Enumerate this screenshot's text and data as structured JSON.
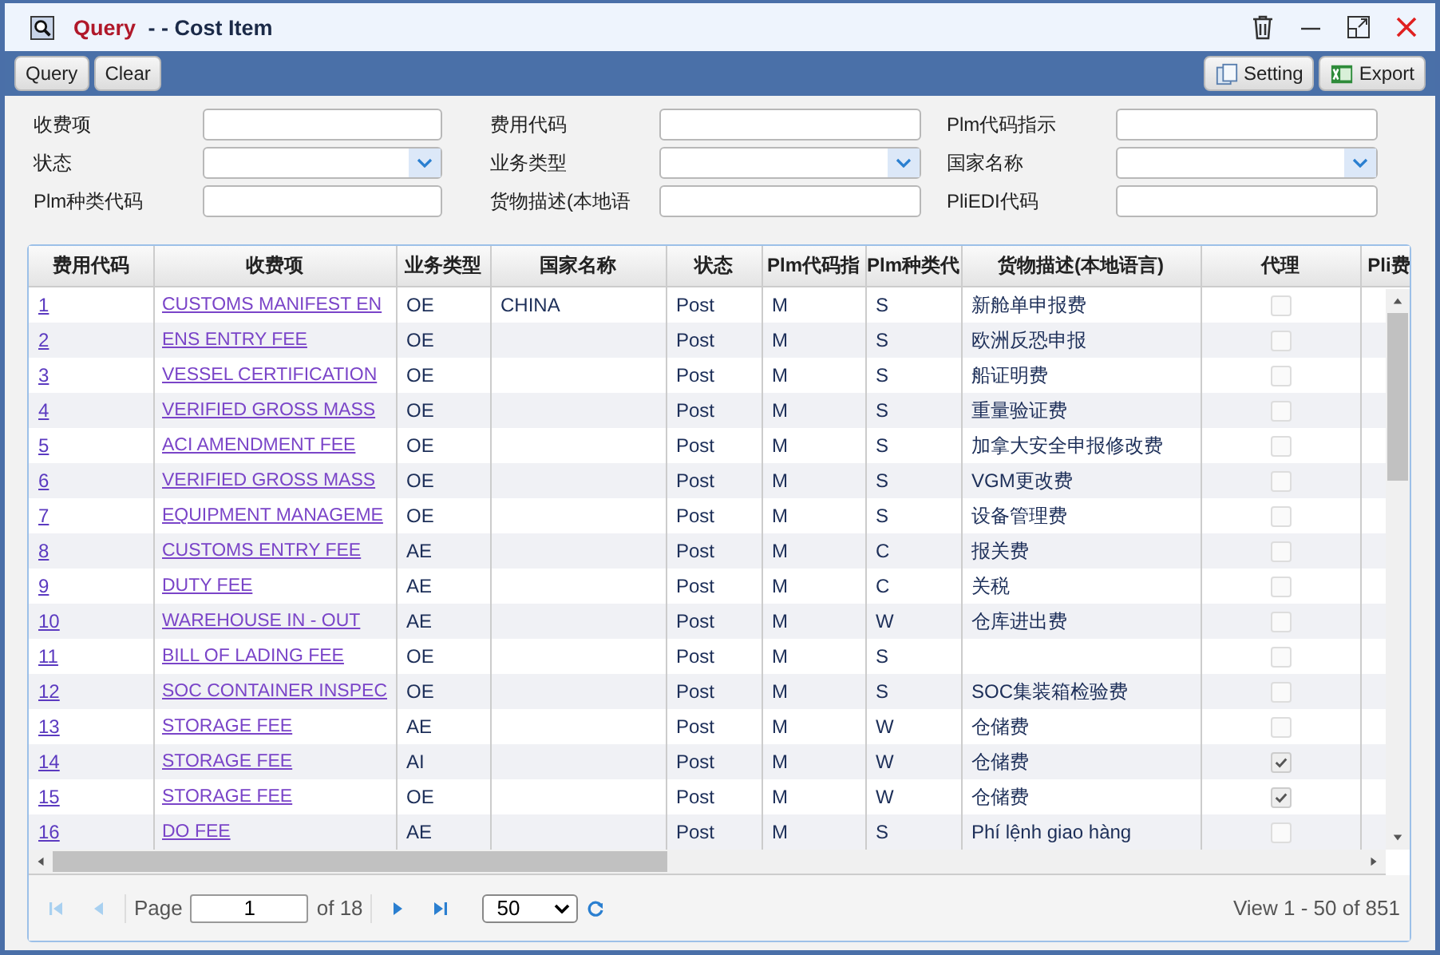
{
  "window": {
    "title_prefix": "Query",
    "title_rest": " - - Cost Item"
  },
  "toolbar": {
    "left": [
      {
        "label": "Query"
      },
      {
        "label": "Clear"
      }
    ],
    "right": [
      {
        "label": "Setting",
        "kind": "setting"
      },
      {
        "label": "Export",
        "kind": "excel"
      }
    ]
  },
  "form": [
    {
      "label": "收费项",
      "kind": "text"
    },
    {
      "label": "费用代码",
      "kind": "text"
    },
    {
      "label": "Plm代码指示",
      "kind": "text"
    },
    {
      "label": "状态",
      "kind": "select"
    },
    {
      "label": "业务类型",
      "kind": "select"
    },
    {
      "label": "国家名称",
      "kind": "select"
    },
    {
      "label": "Plm种类代码",
      "kind": "text"
    },
    {
      "label": "货物描述(本地语",
      "kind": "text"
    },
    {
      "label": "PliEDI代码",
      "kind": "text"
    }
  ],
  "table": {
    "columns": [
      "费用代码",
      "收费项",
      "业务类型",
      "国家名称",
      "状态",
      "Plm代码指",
      "Plm种类代",
      "货物描述(本地语言)",
      "代理",
      "Pli费"
    ],
    "rows": [
      {
        "code": "1",
        "item": "CUSTOMS MANIFEST EN",
        "business_type": "OE",
        "country": "CHINA",
        "status": "Post",
        "plm_code": "M",
        "plm_kind": "S",
        "description": "新舱单申报费",
        "checked": false
      },
      {
        "code": "2",
        "item": "ENS ENTRY FEE",
        "business_type": "OE",
        "country": "",
        "status": "Post",
        "plm_code": "M",
        "plm_kind": "S",
        "description": "欧洲反恐申报",
        "checked": false
      },
      {
        "code": "3",
        "item": "VESSEL CERTIFICATION",
        "business_type": "OE",
        "country": "",
        "status": "Post",
        "plm_code": "M",
        "plm_kind": "S",
        "description": "船证明费",
        "checked": false
      },
      {
        "code": "4",
        "item": "VERIFIED GROSS MASS",
        "business_type": "OE",
        "country": "",
        "status": "Post",
        "plm_code": "M",
        "plm_kind": "S",
        "description": "重量验证费",
        "checked": false
      },
      {
        "code": "5",
        "item": "ACI AMENDMENT FEE",
        "business_type": "OE",
        "country": "",
        "status": "Post",
        "plm_code": "M",
        "plm_kind": "S",
        "description": "加拿大安全申报修改费",
        "checked": false
      },
      {
        "code": "6",
        "item": "VERIFIED GROSS MASS",
        "business_type": "OE",
        "country": "",
        "status": "Post",
        "plm_code": "M",
        "plm_kind": "S",
        "description": "VGM更改费",
        "checked": false
      },
      {
        "code": "7",
        "item": "EQUIPMENT MANAGEME",
        "business_type": "OE",
        "country": "",
        "status": "Post",
        "plm_code": "M",
        "plm_kind": "S",
        "description": "设备管理费",
        "checked": false
      },
      {
        "code": "8",
        "item": "CUSTOMS ENTRY FEE",
        "business_type": "AE",
        "country": "",
        "status": "Post",
        "plm_code": "M",
        "plm_kind": "C",
        "description": "报关费",
        "checked": false
      },
      {
        "code": "9",
        "item": "DUTY FEE",
        "business_type": "AE",
        "country": "",
        "status": "Post",
        "plm_code": "M",
        "plm_kind": "C",
        "description": "关税",
        "checked": false
      },
      {
        "code": "10",
        "item": "WAREHOUSE IN - OUT",
        "business_type": "AE",
        "country": "",
        "status": "Post",
        "plm_code": "M",
        "plm_kind": "W",
        "description": "仓库进出费",
        "checked": false
      },
      {
        "code": "11",
        "item": "BILL OF LADING FEE",
        "business_type": "OE",
        "country": "",
        "status": "Post",
        "plm_code": "M",
        "plm_kind": "S",
        "description": "",
        "checked": false
      },
      {
        "code": "12",
        "item": "SOC CONTAINER INSPEC",
        "business_type": "OE",
        "country": "",
        "status": "Post",
        "plm_code": "M",
        "plm_kind": "S",
        "description": "SOC集装箱检验费",
        "checked": false
      },
      {
        "code": "13",
        "item": "STORAGE FEE",
        "business_type": "AE",
        "country": "",
        "status": "Post",
        "plm_code": "M",
        "plm_kind": "W",
        "description": "仓储费",
        "checked": false
      },
      {
        "code": "14",
        "item": "STORAGE FEE",
        "business_type": "AI",
        "country": "",
        "status": "Post",
        "plm_code": "M",
        "plm_kind": "W",
        "description": "仓储费",
        "checked": true
      },
      {
        "code": "15",
        "item": "STORAGE FEE",
        "business_type": "OE",
        "country": "",
        "status": "Post",
        "plm_code": "M",
        "plm_kind": "W",
        "description": "仓储费",
        "checked": true
      },
      {
        "code": "16",
        "item": "DO FEE",
        "business_type": "AE",
        "country": "",
        "status": "Post",
        "plm_code": "M",
        "plm_kind": "S",
        "description": "Phí lệnh giao hàng",
        "checked": false
      }
    ]
  },
  "pager": {
    "nav_back": [
      {
        "kind": "first",
        "disabled": true
      },
      {
        "kind": "prev",
        "disabled": true
      }
    ],
    "page_label": "Page",
    "page": "1",
    "of": "of 18",
    "nav_fwd": [
      {
        "kind": "next",
        "disabled": false
      },
      {
        "kind": "last",
        "disabled": false
      }
    ],
    "page_size": "50",
    "summary": "View 1 - 50 of 851"
  }
}
